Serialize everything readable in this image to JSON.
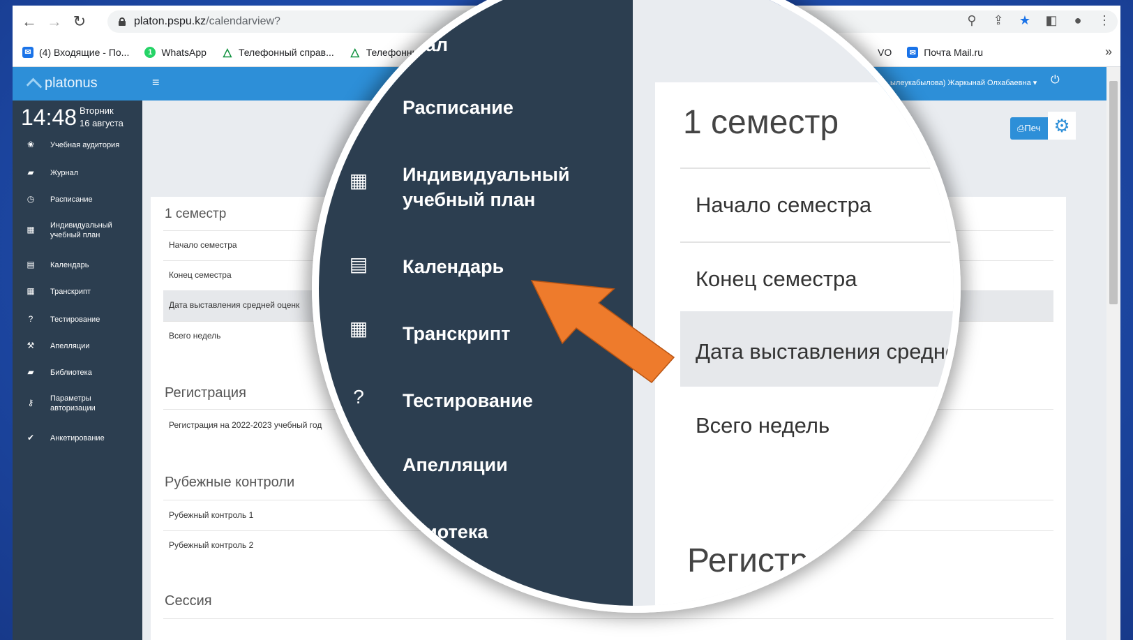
{
  "browser": {
    "url_host": "platon.pspu.kz",
    "url_path": "/calendarview?",
    "bookmarks": [
      {
        "label": "(4) Входящие - По...",
        "icon": "mail-icon",
        "color": "#1a73e8"
      },
      {
        "label": "WhatsApp",
        "icon": "whatsapp-icon",
        "color": "#25d366"
      },
      {
        "label": "Телефонный справ...",
        "icon": "triangle-icon",
        "color": "#0b8f3a"
      },
      {
        "label": "Телефонный",
        "icon": "triangle-icon",
        "color": "#0b8f3a"
      }
    ],
    "bookmarks_right": [
      {
        "label": "VO",
        "icon": "",
        "color": ""
      },
      {
        "label": "Почта Mail.ru",
        "icon": "mail-icon",
        "color": "#1a73e8"
      }
    ],
    "more": "»"
  },
  "app": {
    "brand": "platonus",
    "hamburger": "≡",
    "user": "ылеукабылова) Жаркынай Олхабаевна ▾",
    "print_label": "Печ"
  },
  "sidebar": {
    "time": "14:48",
    "weekday": "Вторник",
    "date": "16 августа",
    "items": [
      {
        "label": "Учебная аудитория",
        "icon": "users-icon",
        "glyph": "❀"
      },
      {
        "label": "Журнал",
        "icon": "book-icon",
        "glyph": "▰"
      },
      {
        "label": "Расписание",
        "icon": "clock-icon",
        "glyph": "◷"
      },
      {
        "label": "Индивидуальный учебный план",
        "icon": "grid-icon",
        "glyph": "▦"
      },
      {
        "label": "Календарь",
        "icon": "calendar-icon",
        "glyph": "▤"
      },
      {
        "label": "Транскрипт",
        "icon": "table-icon",
        "glyph": "▦"
      },
      {
        "label": "Тестирование",
        "icon": "question-icon",
        "glyph": "?"
      },
      {
        "label": "Апелляции",
        "icon": "gavel-icon",
        "glyph": "⚒"
      },
      {
        "label": "Библиотека",
        "icon": "book-icon",
        "glyph": "▰"
      },
      {
        "label": "Параметры авторизации",
        "icon": "key-icon",
        "glyph": "⚷"
      },
      {
        "label": "Анкетирование",
        "icon": "check-circle-icon",
        "glyph": "✔"
      }
    ]
  },
  "main": {
    "semester_title": "1 семестр",
    "semester_rows": [
      "Начало семестра",
      "Конец семестра",
      "Дата выставления средней оценк",
      "Всего недель"
    ],
    "registration_title": "Регистрация",
    "registration_rows": [
      "Регистрация на 2022-2023 учебный год"
    ],
    "midterm_title": "Рубежные контроли",
    "midterm_rows": [
      "Рубежный контроль 1",
      "Рубежный контроль 2"
    ],
    "session_title": "Сессия"
  },
  "zoom": {
    "menu": [
      {
        "label": "рнал",
        "icon": ""
      },
      {
        "label": "Расписание",
        "icon": ""
      },
      {
        "label": "Индивидуальный учебный план",
        "icon": "grid-icon"
      },
      {
        "label": "Календарь",
        "icon": "calendar-icon"
      },
      {
        "label": "Транскрипт",
        "icon": "table-icon"
      },
      {
        "label": "Тестирование",
        "icon": "question-icon"
      },
      {
        "label": "Апелляции",
        "icon": "gavel-icon"
      },
      {
        "label": "блиотека",
        "icon": ""
      }
    ],
    "title": "1 семестр",
    "rows": [
      "Начало семестра",
      "Конец семестра",
      "Дата выставления средне",
      "Всего недель"
    ],
    "registration": "Регистр",
    "arrow_color": "#ee7b2c"
  }
}
